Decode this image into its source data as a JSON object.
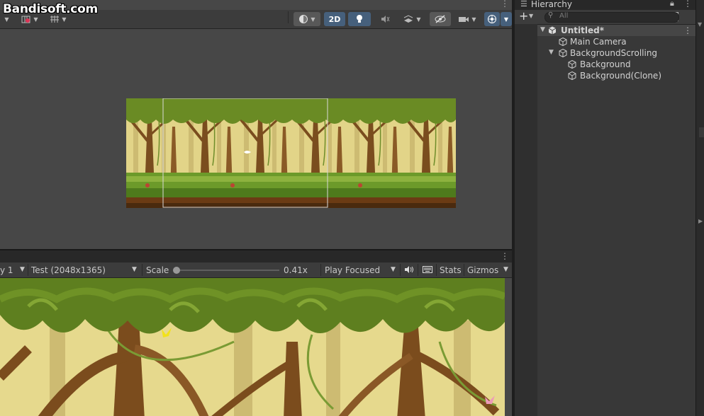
{
  "watermark": "Bandisoft.com",
  "scene_toolbar": {
    "btn_2d": "2D",
    "icons": [
      "shading-mode-icon",
      "2d-toggle",
      "lighting-icon",
      "audio-icon",
      "effects-icon",
      "scene-visibility-icon",
      "camera-icon",
      "gizmos-icon"
    ]
  },
  "game_toolbar": {
    "display": "y 1",
    "resolution": "Test (2048x1365)",
    "scale_label": "Scale",
    "scale_value": 0.41,
    "scale_text": "0.41x",
    "play_mode": "Play Focused",
    "stats": "Stats",
    "gizmos": "Gizmos"
  },
  "hierarchy": {
    "title": "Hierarchy",
    "search_placeholder": "All",
    "items": [
      {
        "label": "Untitled*",
        "level": 0,
        "expanded": true
      },
      {
        "label": "Main Camera",
        "level": 1
      },
      {
        "label": "BackgroundScrolling",
        "level": 1,
        "expanded": true
      },
      {
        "label": "Background",
        "level": 2
      },
      {
        "label": "Background(Clone)",
        "level": 2
      }
    ]
  },
  "colors": {
    "accent": "#46607c",
    "panel": "#383838",
    "scene_bg": "#474747",
    "forest_canopy": "#5a7a1c",
    "forest_sky": "#e3d487"
  }
}
